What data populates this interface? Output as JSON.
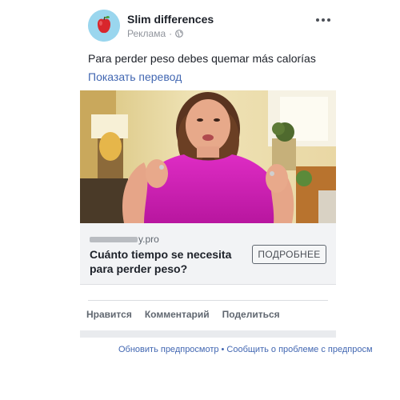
{
  "post": {
    "page_name": "Slim differences",
    "sponsored_label": "Реклама",
    "meta_separator": "·",
    "body_text": "Para perder peso debes quemar más calorías",
    "translate_link": "Показать перевод"
  },
  "ad_card": {
    "domain_suffix": "y.pro",
    "headline": "Cuánto tiempo se necesita para perder peso?",
    "cta_label": "ПОДРОБНЕЕ"
  },
  "actions": {
    "like": "Нравится",
    "comment": "Комментарий",
    "share": "Поделиться"
  },
  "footer": {
    "refresh_preview": "Обновить предпросмотр",
    "separator": "•",
    "report_problem": "Сообщить о проблеме с предпросм"
  },
  "icons": {
    "avatar": "apple-icon",
    "privacy": "globe-icon",
    "menu": "more-options-icon"
  },
  "colors": {
    "link": "#4267b2",
    "text": "#1d2129",
    "secondary_text": "#90949c",
    "card_bg": "#f2f3f5",
    "avatar_bg": "#9ad6ee",
    "shirt": "#d420b8"
  }
}
